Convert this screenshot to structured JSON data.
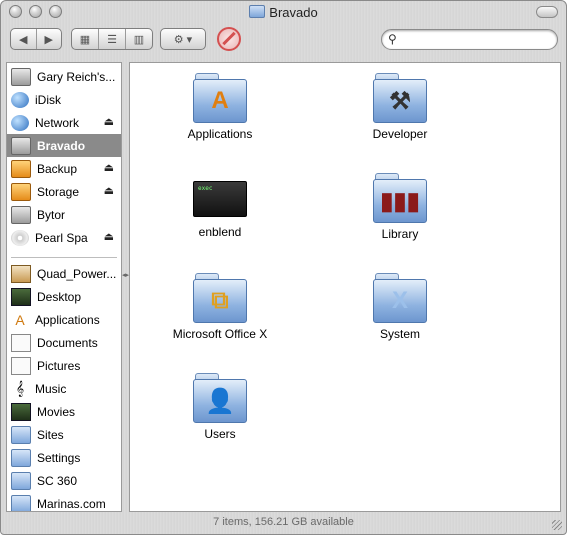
{
  "window": {
    "title": "Bravado",
    "status_text": "7 items, 156.21 GB available"
  },
  "toolbar": {
    "back_icon": "back-arrow-icon",
    "forward_icon": "forward-arrow-icon",
    "view_icons": [
      "icon-view-icon",
      "list-view-icon",
      "column-view-icon"
    ],
    "action_icon": "gear-icon",
    "stop_icon": "no-entry-icon",
    "search_value": ""
  },
  "sidebar": {
    "devices": [
      {
        "label": "Gary Reich's...",
        "icon": "computer-icon",
        "eject": false,
        "selected": false
      },
      {
        "label": "iDisk",
        "icon": "idisk-icon",
        "eject": false,
        "selected": false
      },
      {
        "label": "Network",
        "icon": "network-globe-icon",
        "eject": true,
        "selected": false
      },
      {
        "label": "Bravado",
        "icon": "hard-drive-icon",
        "eject": false,
        "selected": true
      },
      {
        "label": "Backup",
        "icon": "firewire-drive-icon",
        "eject": true,
        "selected": false
      },
      {
        "label": "Storage",
        "icon": "firewire-drive-icon",
        "eject": true,
        "selected": false
      },
      {
        "label": "Bytor",
        "icon": "hard-drive-icon",
        "eject": false,
        "selected": false
      },
      {
        "label": "Pearl Spa",
        "icon": "dvd-icon",
        "eject": true,
        "selected": false
      }
    ],
    "places": [
      {
        "label": "Quad_Power...",
        "icon": "home-icon"
      },
      {
        "label": "Desktop",
        "icon": "desktop-icon"
      },
      {
        "label": "Applications",
        "icon": "applications-icon"
      },
      {
        "label": "Documents",
        "icon": "documents-icon"
      },
      {
        "label": "Pictures",
        "icon": "pictures-icon"
      },
      {
        "label": "Music",
        "icon": "music-icon"
      },
      {
        "label": "Movies",
        "icon": "movies-icon"
      },
      {
        "label": "Sites",
        "icon": "folder-icon"
      },
      {
        "label": "Settings",
        "icon": "folder-icon"
      },
      {
        "label": "SC 360",
        "icon": "folder-icon"
      },
      {
        "label": "Marinas.com",
        "icon": "folder-icon"
      }
    ]
  },
  "items": [
    {
      "label": "Applications",
      "icon": "applications-folder-icon"
    },
    {
      "label": "Developer",
      "icon": "developer-folder-icon"
    },
    {
      "label": "enblend",
      "icon": "terminal-executable-icon"
    },
    {
      "label": "Library",
      "icon": "library-folder-icon"
    },
    {
      "label": "Microsoft Office X",
      "icon": "office-folder-icon"
    },
    {
      "label": "System",
      "icon": "system-folder-icon"
    },
    {
      "label": "Users",
      "icon": "users-folder-icon"
    }
  ]
}
